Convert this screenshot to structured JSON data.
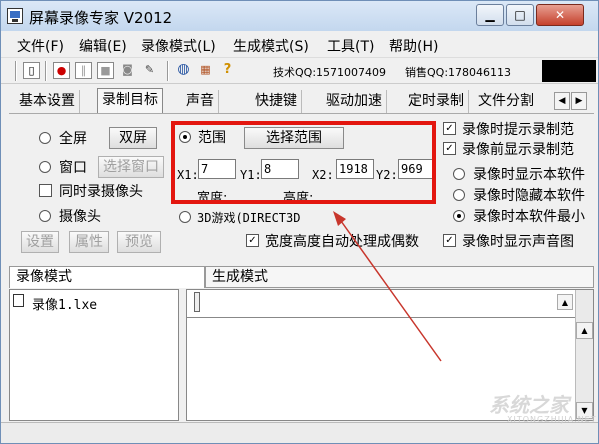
{
  "window": {
    "title": "屏幕录像专家 V2012",
    "minimize": "▁",
    "maximize": "□",
    "close": "✕"
  },
  "menu": [
    "文件(F)",
    "编辑(E)",
    "录像模式(L)",
    "生成模式(S)",
    "工具(T)",
    "帮助(H)"
  ],
  "toolbar": {
    "buttons": [
      "new-icon",
      "record-icon",
      "pause-icon",
      "stop-icon",
      "camera-icon",
      "pen-icon",
      "globe-icon",
      "gift-icon",
      "help-icon"
    ],
    "tech_qq": "技术QQ:1571007409",
    "sales_qq": "销售QQ:178046113"
  },
  "tabs": [
    "基本设置",
    "录制目标",
    "声音",
    "快捷键",
    "驱动加速",
    "定时录制",
    "文件分割"
  ],
  "tab_arrows": {
    "left": "◀",
    "right": "▶"
  },
  "target": {
    "fullscreen": "全屏",
    "dual_screen": "双屏",
    "window": "窗口",
    "select_window": "选择窗口",
    "record_camera": "同时录摄像头",
    "camera": "摄像头",
    "setup": "设置",
    "properties": "属性",
    "preview": "预览",
    "range": "范围",
    "select_range": "选择范围",
    "x1_label": "X1:",
    "x1": "7",
    "y1_label": "Y1:",
    "y1": "8",
    "x2_label": "X2:",
    "x2": "1918",
    "y2_label": "Y2:",
    "y2": "969",
    "width_label": "宽度:",
    "height_label": "高度:",
    "game3d": "3D游戏(DIRECT3D",
    "auto_even": "宽度高度自动处理成偶数"
  },
  "options": {
    "prompt_range": "录像时提示录制范",
    "show_range_before": "录像前显示录制范",
    "show_app": "录像时显示本软件",
    "hide_app": "录像时隐藏本软件",
    "minimize_app": "录像时本软件最小",
    "show_sound_icon": "录像时显示声音图"
  },
  "bottom_tabs": [
    "录像模式",
    "生成模式"
  ],
  "file_list": [
    "录像1.lxe"
  ],
  "watermark": {
    "main": "系统之家",
    "sub": "XITONGZHIJIA.NET"
  },
  "colors": {
    "highlight_box": "#e3160f",
    "title_gradient": "#c3d7ee"
  }
}
